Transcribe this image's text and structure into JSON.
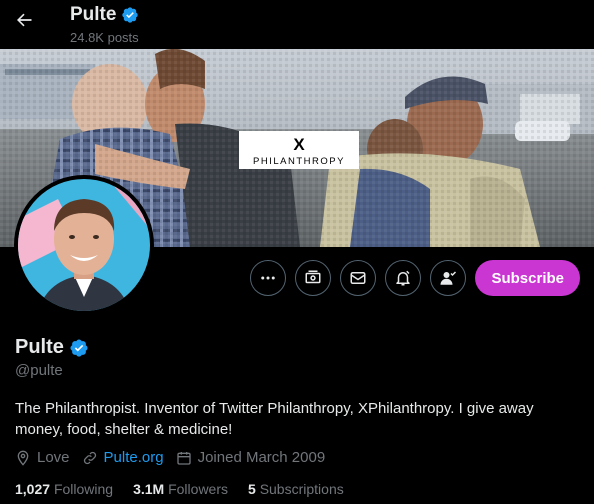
{
  "header": {
    "title": "Pulte",
    "posts_count": "24.8K posts"
  },
  "banner": {
    "logo_mark": "X",
    "logo_word": "PHILANTHROPY"
  },
  "actions": {
    "subscribe_label": "Subscribe"
  },
  "profile": {
    "name": "Pulte",
    "handle": "@pulte",
    "bio": "The Philanthropist. Inventor of Twitter Philanthropy, XPhilanthropy. I give away money, food, shelter & medicine!",
    "location": "Love",
    "website": "Pulte.org",
    "joined": "Joined March 2009"
  },
  "stats": {
    "following_count": "1,027",
    "following_label": "Following",
    "followers_count": "3.1M",
    "followers_label": "Followers",
    "subscriptions_count": "5",
    "subscriptions_label": "Subscriptions"
  },
  "colors": {
    "accent": "#1d9bf0",
    "subscribe": "#c936d1",
    "background": "#000000",
    "muted": "#71767b"
  },
  "icons": [
    "back-arrow-icon",
    "verified-badge-icon",
    "more-icon",
    "money-icon",
    "mail-icon",
    "notification-bell-icon",
    "person-check-icon",
    "location-icon",
    "link-icon",
    "calendar-icon"
  ]
}
